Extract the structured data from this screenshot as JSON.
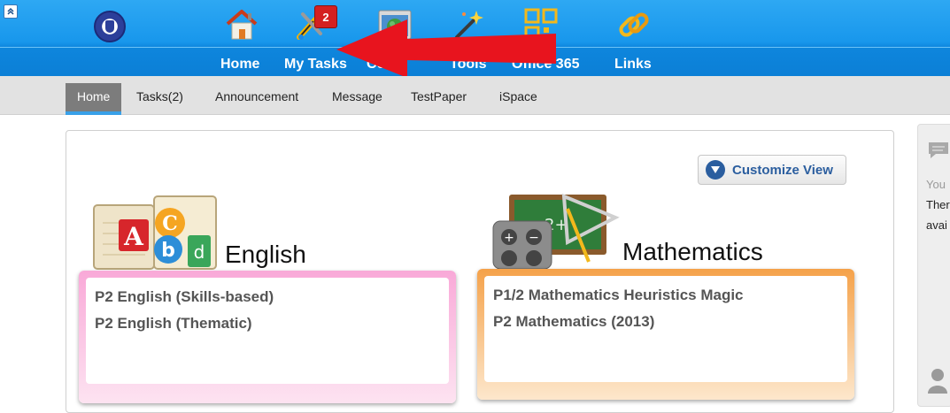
{
  "topnav": {
    "badge_count": "2",
    "items": [
      {
        "label": "Home",
        "icon": "home-icon"
      },
      {
        "label": "My Tasks",
        "icon": "tasks-icon"
      },
      {
        "label": "Conte",
        "icon": "content-icon"
      },
      {
        "label": "Tools",
        "icon": "tools-icon"
      },
      {
        "label": "Office 365",
        "icon": "office365-icon"
      },
      {
        "label": "Links",
        "icon": "links-icon"
      }
    ]
  },
  "subnav": {
    "tabs": [
      {
        "label": "Home",
        "active": true
      },
      {
        "label": "Tasks(2)"
      },
      {
        "label": "Announcement"
      },
      {
        "label": "Message"
      },
      {
        "label": "TestPaper"
      },
      {
        "label": "iSpace"
      }
    ]
  },
  "main": {
    "customize_label": "Customize View",
    "subjects": [
      {
        "title": "English",
        "courses": [
          "P2 English (Skills-based)",
          "P2 English (Thematic)"
        ]
      },
      {
        "title": "Mathematics",
        "courses": [
          "P1/2 Mathematics Heuristics Magic",
          "P2 Mathematics (2013)"
        ]
      }
    ]
  },
  "side_panel": {
    "line1": "You",
    "line2": "Ther",
    "line3": "avai"
  },
  "colors": {
    "nav_blue": "#1897ec",
    "badge_red": "#d42020",
    "arrow_red": "#e8141e",
    "english_card": "#f9a9d8",
    "math_card": "#f5a24a",
    "customize_blue": "#2b5e9f"
  }
}
